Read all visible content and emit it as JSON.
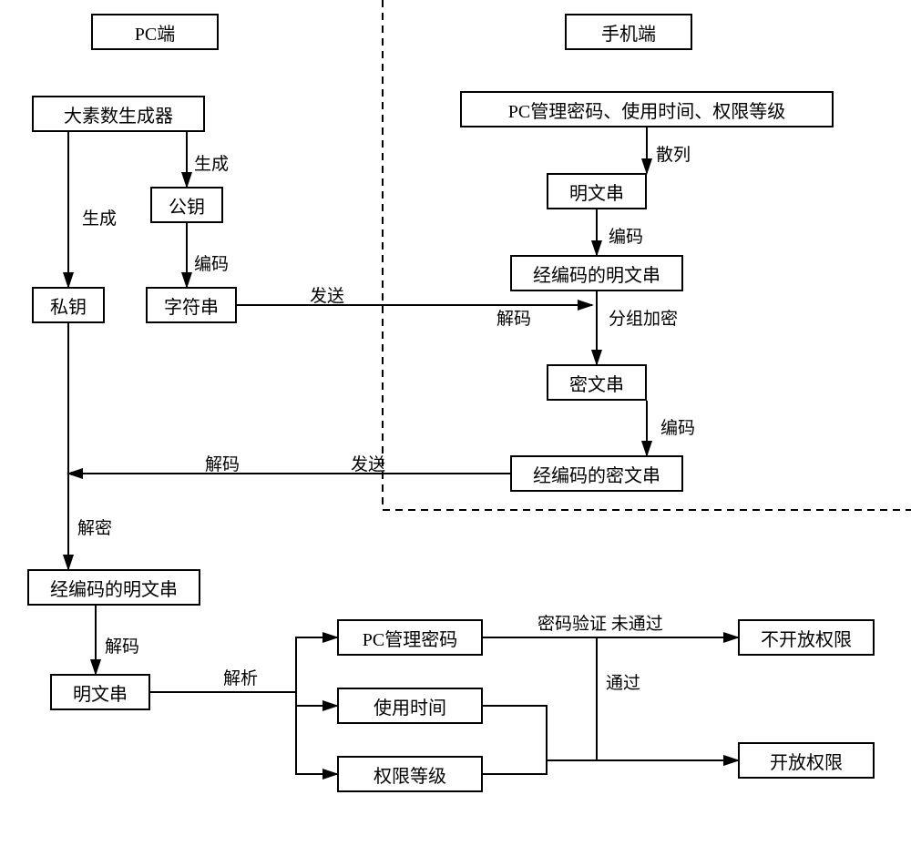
{
  "titles": {
    "pc_side": "PC端",
    "phone_side": "手机端"
  },
  "pc": {
    "prime_generator": "大素数生成器",
    "public_key": "公钥",
    "private_key": "私钥",
    "string_box": "字符串",
    "encoded_plaintext": "经编码的明文串",
    "plaintext": "明文串"
  },
  "phone": {
    "input_info": "PC管理密码、使用时间、权限等级",
    "plaintext": "明文串",
    "encoded_plaintext": "经编码的明文串",
    "ciphertext": "密文串",
    "encoded_ciphertext": "经编码的密文串"
  },
  "result": {
    "pc_password": "PC管理密码",
    "usage_time": "使用时间",
    "permission_level": "权限等级",
    "deny": "不开放权限",
    "grant": "开放权限"
  },
  "edges": {
    "generate": "生成",
    "encode": "编码",
    "hash": "散列",
    "decode": "解码",
    "send": "发送",
    "group_encrypt": "分组加密",
    "decrypt": "解密",
    "parse": "解析",
    "verify_fail": "密码验证 未通过",
    "pass": "通过"
  }
}
